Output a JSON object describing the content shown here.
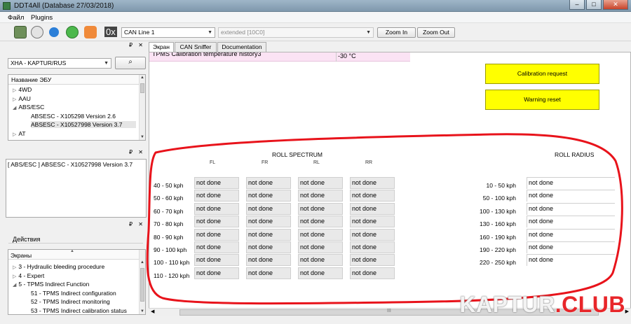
{
  "window": {
    "title": "DDT4All (Database 27/03/2018)",
    "minimize": "–",
    "maximize": "□",
    "close": "✕"
  },
  "menu": [
    "Файл",
    "Plugins"
  ],
  "toolbar": {
    "hex_label": "0x",
    "can_line": "CAN Line 1",
    "protocol": "extended [10C0]",
    "zoom_in": "Zoom In",
    "zoom_out": "Zoom Out",
    "icons": [
      "ecu-connect-icon",
      "ecu-scan-icon",
      "refresh-icon",
      "green-refresh-icon",
      "heart-monitor-icon"
    ]
  },
  "left": {
    "vehicle_select": "XHA - KAPTUR/RUS",
    "ecu_list_header": "Название ЭБУ",
    "ecu_tree": [
      {
        "label": "4WD",
        "tw": "▷",
        "level": 0
      },
      {
        "label": "AAU",
        "tw": "▷",
        "level": 0
      },
      {
        "label": "ABS/ESC",
        "tw": "◢",
        "level": 0
      },
      {
        "label": "ABSESC - X105298 Version 2.6",
        "tw": "",
        "level": 1
      },
      {
        "label": "ABSESC - X10527998 Version 3.7",
        "tw": "",
        "level": 1,
        "selected": true
      },
      {
        "label": "AT",
        "tw": "▷",
        "level": 0
      }
    ],
    "current_ecu": "[ ABS/ESC ] ABSESC - X10527998 Version 3.7",
    "actions_tab": "Действия",
    "screens_header": "Экраны",
    "screens_tree": [
      {
        "label": "3 - Hydraulic bleeding procedure",
        "tw": "▷",
        "level": 0
      },
      {
        "label": "4 - Expert",
        "tw": "▷",
        "level": 0
      },
      {
        "label": "5 - TPMS Indirect Function",
        "tw": "◢",
        "level": 0
      },
      {
        "label": "51 - TPMS Indirect configuration",
        "tw": "",
        "level": 1
      },
      {
        "label": "52 - TPMS Indirect monitoring",
        "tw": "",
        "level": 1
      },
      {
        "label": "53 - TPMS Indirect calibration status",
        "tw": "",
        "level": 1
      }
    ],
    "dock_controls": "₽ ✕"
  },
  "tabs": [
    "Экран",
    "CAN Sniffer",
    "Documentation"
  ],
  "screen": {
    "top_row_label": "TPMS Calibration temperature history3",
    "top_row_value": "-30 °C",
    "calibration_request": "Calibration request",
    "warning_reset": "Warning reset",
    "roll_spectrum_title": "ROLL SPECTRUM",
    "roll_radius_title": "ROLL RADIUS",
    "wheel_headers": [
      "FL",
      "FR",
      "RL",
      "RR"
    ],
    "spectrum_rows": [
      "40 - 50 kph",
      "50 - 60 kph",
      "60 - 70 kph",
      "70 - 80 kph",
      "80 - 90 kph",
      "90 - 100 kph",
      "100 - 110 kph",
      "110 - 120 kph"
    ],
    "radius_rows": [
      "10 - 50 kph",
      "50 - 100 kph",
      "100 - 130 kph",
      "130 - 160 kph",
      "160 - 190 kph",
      "190 - 220 kph",
      "220 - 250 kph"
    ],
    "cell_value": "not done"
  },
  "hscroll_center": "III",
  "watermark": {
    "left": "KAPTUR",
    "right": ".CLUB"
  }
}
